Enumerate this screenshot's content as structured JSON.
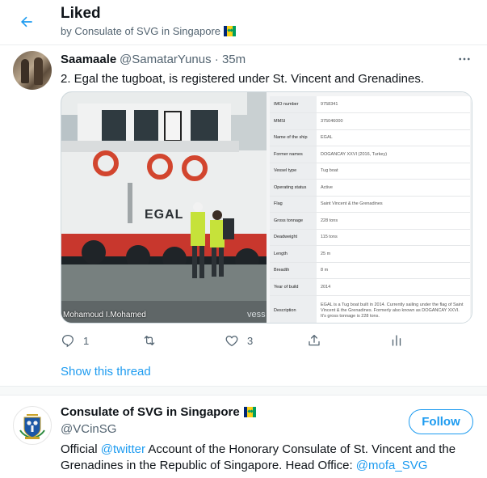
{
  "header": {
    "title": "Liked",
    "subtitle": "by Consulate of SVG in Singapore",
    "back_icon": "arrow-left-icon",
    "accent": "#1d9bf0"
  },
  "tweet": {
    "author_name": "Saamaale",
    "author_handle": "@SamatarYunus",
    "separator": "·",
    "time": "35m",
    "text": "2. Egal the tugboat, is registered under St. Vincent and Grenadines.",
    "media": {
      "photo_label": "EGAL",
      "photo_caption": "Mohamoud I.Mohamed",
      "photo_watermark": "vess",
      "vessel_info": [
        {
          "key": "IMO number",
          "value": "9758341"
        },
        {
          "key": "MMSI",
          "value": "375046000"
        },
        {
          "key": "Name of the ship",
          "value": "EGAL"
        },
        {
          "key": "Former names",
          "value": "DOGANCAY XXVI (2016, Turkey)"
        },
        {
          "key": "Vessel type",
          "value": "Tug boat"
        },
        {
          "key": "Operating status",
          "value": "Active"
        },
        {
          "key": "Flag",
          "value": "Saint Vincent & the Grenadines"
        },
        {
          "key": "Gross tonnage",
          "value": "228 tons"
        },
        {
          "key": "Deadweight",
          "value": "115 tons"
        },
        {
          "key": "Length",
          "value": "25 m"
        },
        {
          "key": "Breadth",
          "value": "8 m"
        },
        {
          "key": "Year of build",
          "value": "2014"
        },
        {
          "key": "Description",
          "value": "EGAL is a Tug boat built in 2014. Currently sailing under the flag of Saint Vincent & the Grenadines. Formerly also known as DOGANCAY XXVI. It's gross tonnage is 228 tons."
        }
      ]
    },
    "actions": {
      "reply_count": "1",
      "retweet_count": "",
      "like_count": "3"
    },
    "show_thread": "Show this thread"
  },
  "profile": {
    "name": "Consulate of SVG in Singapore",
    "handle": "@VCinSG",
    "follow_label": "Follow",
    "bio_part1": "Official ",
    "bio_link1": "@twitter",
    "bio_part2": " Account of the Honorary Consulate of St. Vincent and the Grenadines in the Republic of Singapore. Head Office: ",
    "bio_link2": "@mofa_SVG"
  }
}
